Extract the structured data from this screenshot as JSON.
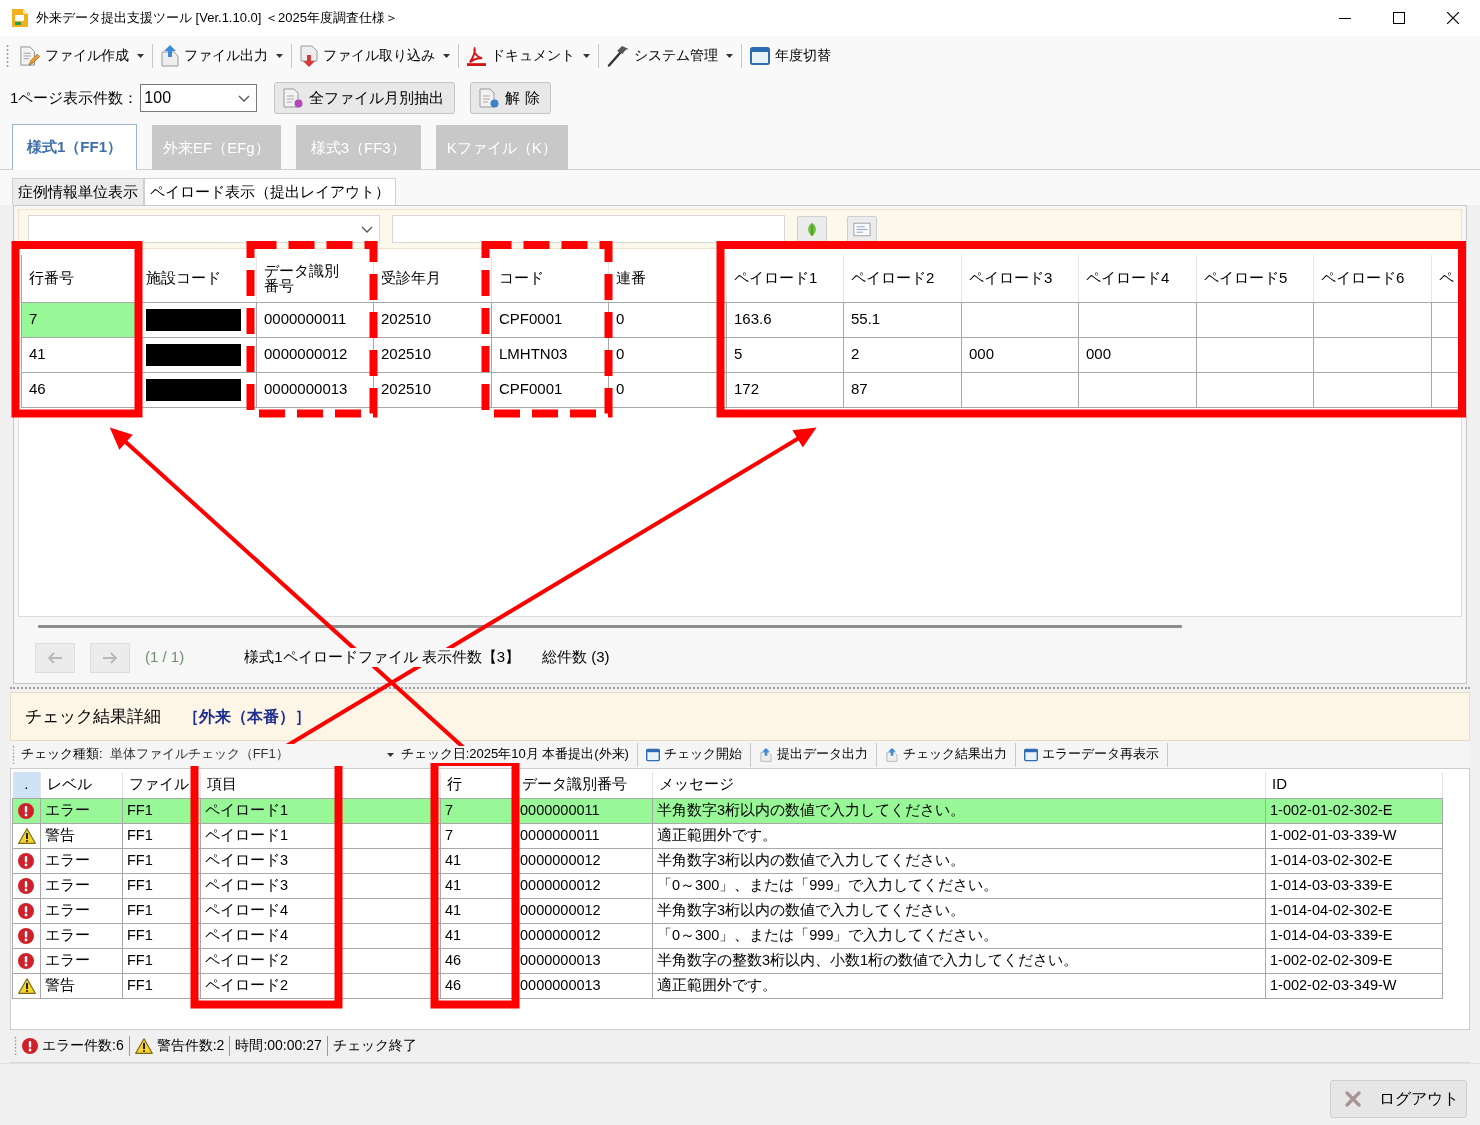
{
  "window": {
    "title": "外来データ提出支援ツール [Ver.1.10.0] ＜2025年度調査仕様＞"
  },
  "toolbar": [
    {
      "label": "ファイル作成",
      "dropdown": true
    },
    {
      "label": "ファイル出力",
      "dropdown": true
    },
    {
      "label": "ファイル取り込み",
      "dropdown": true
    },
    {
      "label": "ドキュメント",
      "dropdown": true
    },
    {
      "label": "システム管理",
      "dropdown": true
    },
    {
      "label": "年度切替",
      "dropdown": false
    }
  ],
  "page_size": {
    "label": "1ページ表示件数：",
    "value": "100"
  },
  "actions": [
    {
      "label": "全ファイル月別抽出"
    },
    {
      "label": "解 除"
    }
  ],
  "tabs": [
    {
      "label": "様式1（FF1）",
      "selected": true
    },
    {
      "label": "外来EF（EFg）",
      "selected": false
    },
    {
      "label": "様式3（FF3）",
      "selected": false
    },
    {
      "label": "Kファイル（K）",
      "selected": false
    }
  ],
  "subtabs": [
    {
      "label": "症例情報単位表示",
      "selected": false
    },
    {
      "label": "ペイロード表示（提出レイアウト）",
      "selected": true
    }
  ],
  "grid": {
    "columns": [
      {
        "label": "行番号",
        "frame": {
          "kind": "solid",
          "arrow_to": true
        }
      },
      {
        "label": "施設コード"
      },
      {
        "label": "データ識別番号",
        "frame": {
          "kind": "dashed"
        }
      },
      {
        "label": "受診年月"
      },
      {
        "label": "コード",
        "frame": {
          "kind": "dashed"
        }
      },
      {
        "label": "連番"
      },
      {
        "label": "ペイロード1",
        "frame": {
          "kind": "solid",
          "arrow_to": true
        }
      },
      {
        "label": "ペイロード2",
        "frame": {
          "kind": "solid",
          "joined": true
        }
      },
      {
        "label": "ペイロード3",
        "frame": {
          "kind": "solid",
          "joined": true
        }
      },
      {
        "label": "ペイロード4",
        "frame": {
          "kind": "solid",
          "joined": true
        }
      },
      {
        "label": "ペイロード5",
        "frame": {
          "kind": "solid",
          "joined": true
        }
      },
      {
        "label": "ペイロード6",
        "frame": {
          "kind": "solid",
          "joined": true
        }
      },
      {
        "label": "ペ",
        "frame": {
          "kind": "solid",
          "joined": true
        }
      }
    ],
    "rows": [
      {
        "selected": true,
        "cells": [
          "7",
          {
            "redacted": true
          },
          "0000000011",
          "202510",
          "CPF0001",
          "0",
          "163.6",
          "55.1"
        ]
      },
      {
        "selected": false,
        "cells": [
          "41",
          {
            "redacted": true
          },
          "0000000012",
          "202510",
          "LMHTN03",
          "0",
          "5",
          "2",
          "000",
          "000"
        ]
      },
      {
        "selected": false,
        "cells": [
          "46",
          {
            "redacted": true
          },
          "0000000013",
          "202510",
          "CPF0001",
          "0",
          "172",
          "87"
        ]
      }
    ]
  },
  "pager": {
    "buttons": [
      {
        "kind": "prev",
        "disabled": true
      },
      {
        "kind": "next",
        "disabled": true
      }
    ],
    "page": "(1 / 1)",
    "summary": "様式1ペイロードファイル 表示件数【3】",
    "total": "総件数 (3)"
  },
  "check": {
    "title": "チェック結果詳細",
    "mode": "［外来（本番）］",
    "type_label": "チェック種類:",
    "type_value": "単体ファイルチェック（FF1）",
    "date": "チェック日:2025年10月 本番提出(外来)",
    "actions": [
      "チェック開始",
      "提出データ出力",
      "チェック結果出力",
      "エラーデータ再表示"
    ]
  },
  "check_table": {
    "columns": [
      {
        "label": "."
      },
      {
        "label": "レベル"
      },
      {
        "label": "ファイル"
      },
      {
        "label": "項目",
        "frame": {
          "kind": "solid",
          "arrow_from": true
        }
      },
      {
        "label": "行",
        "frame": {
          "kind": "solid",
          "arrow_from": true
        }
      },
      {
        "label": "データ識別番号"
      },
      {
        "label": "メッセージ"
      },
      {
        "label": "ID"
      }
    ],
    "rows": [
      {
        "selected": true,
        "cells": [
          {
            "kind": "error"
          },
          "エラー",
          "FF1",
          "ペイロード1",
          "7",
          "0000000011",
          "半角数字3桁以内の数値で入力してください。",
          "1-002-01-02-302-E"
        ]
      },
      {
        "selected": false,
        "cells": [
          {
            "kind": "warning"
          },
          "警告",
          "FF1",
          "ペイロード1",
          "7",
          "0000000011",
          "適正範囲外です。",
          "1-002-01-03-339-W"
        ]
      },
      {
        "selected": false,
        "cells": [
          {
            "kind": "error"
          },
          "エラー",
          "FF1",
          "ペイロード3",
          "41",
          "0000000012",
          "半角数字3桁以内の数値で入力してください。",
          "1-014-03-02-302-E"
        ]
      },
      {
        "selected": false,
        "cells": [
          {
            "kind": "error"
          },
          "エラー",
          "FF1",
          "ペイロード3",
          "41",
          "0000000012",
          "「0～300」、または「999」で入力してください。",
          "1-014-03-03-339-E"
        ]
      },
      {
        "selected": false,
        "cells": [
          {
            "kind": "error"
          },
          "エラー",
          "FF1",
          "ペイロード4",
          "41",
          "0000000012",
          "半角数字3桁以内の数値で入力してください。",
          "1-014-04-02-302-E"
        ]
      },
      {
        "selected": false,
        "cells": [
          {
            "kind": "error"
          },
          "エラー",
          "FF1",
          "ペイロード4",
          "41",
          "0000000012",
          "「0～300」、または「999」で入力してください。",
          "1-014-04-03-339-E"
        ]
      },
      {
        "selected": false,
        "cells": [
          {
            "kind": "error"
          },
          "エラー",
          "FF1",
          "ペイロード2",
          "46",
          "0000000013",
          "半角数字の整数3桁以内、小数1桁の数値で入力してください。",
          "1-002-02-02-309-E"
        ]
      },
      {
        "selected": false,
        "cells": [
          {
            "kind": "warning"
          },
          "警告",
          "FF1",
          "ペイロード2",
          "46",
          "0000000013",
          "適正範囲外です。",
          "1-002-02-03-349-W"
        ]
      }
    ]
  },
  "status_bar": [
    {
      "kind": "error",
      "text": "エラー件数:6"
    },
    {
      "kind": "warning",
      "text": "警告件数:2"
    },
    {
      "kind": "plain",
      "text": "時間:00:00:27"
    },
    {
      "kind": "plain",
      "text": "チェック終了"
    }
  ],
  "logout": {
    "label": "ログアウト"
  }
}
